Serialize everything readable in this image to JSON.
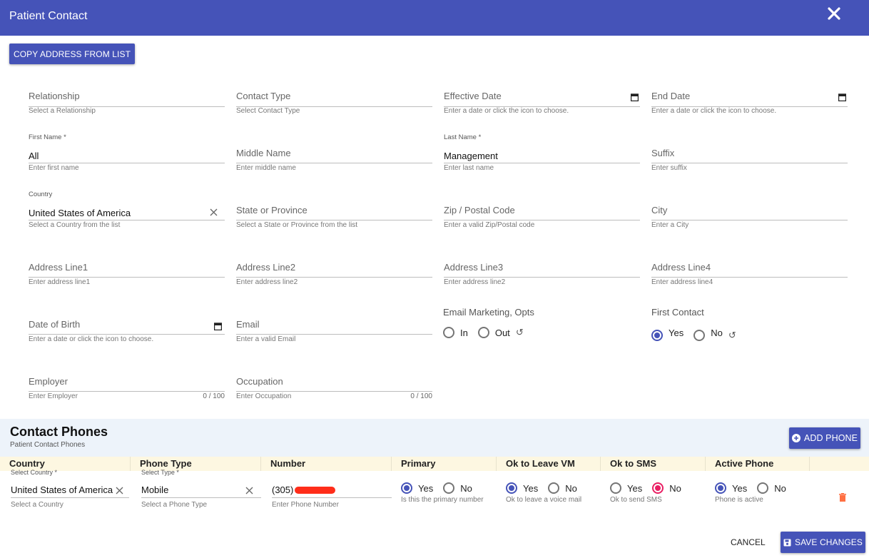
{
  "header": {
    "title": "Patient Contact"
  },
  "copy_button": "COPY ADDRESS FROM LIST",
  "form": {
    "relationship": {
      "label": "Relationship",
      "hint": "Select a Relationship"
    },
    "contact_type": {
      "label": "Contact Type",
      "hint": "Select Contact Type"
    },
    "effective_date": {
      "label": "Effective Date",
      "hint": "Enter a date or click the icon to choose."
    },
    "end_date": {
      "label": "End Date",
      "hint": "Enter a date or click the icon to choose."
    },
    "first_name": {
      "label": "First Name *",
      "value": "All",
      "hint": "Enter first name"
    },
    "middle_name": {
      "label": "Middle Name",
      "hint": "Enter middle name"
    },
    "last_name": {
      "label": "Last Name *",
      "value": "Management",
      "hint": "Enter last name"
    },
    "suffix": {
      "label": "Suffix",
      "hint": "Enter suffix"
    },
    "country": {
      "label": "Country",
      "value": "United States of America",
      "hint": "Select a Country from the list"
    },
    "state": {
      "label": "State or Province",
      "hint": "Select a State or Province from the list"
    },
    "zip": {
      "label": "Zip / Postal Code",
      "hint": "Enter a valid Zip/Postal code"
    },
    "city": {
      "label": "City",
      "hint": "Enter a City"
    },
    "address1": {
      "label": "Address Line1",
      "hint": "Enter address line1"
    },
    "address2": {
      "label": "Address Line2",
      "hint": "Enter address line2"
    },
    "address3": {
      "label": "Address Line3",
      "hint": "Enter address line2"
    },
    "address4": {
      "label": "Address Line4",
      "hint": "Enter address line4"
    },
    "dob": {
      "label": "Date of Birth",
      "hint": "Enter a date or click the icon to choose."
    },
    "email": {
      "label": "Email",
      "hint": "Enter a valid Email"
    },
    "email_marketing": {
      "label": "Email Marketing, Opts",
      "opt_in": "In",
      "opt_out": "Out"
    },
    "first_contact": {
      "label": "First Contact",
      "yes": "Yes",
      "no": "No",
      "selected": "Yes"
    },
    "employer": {
      "label": "Employer",
      "hint": "Enter Employer",
      "count": "0 / 100"
    },
    "occupation": {
      "label": "Occupation",
      "hint": "Enter Occupation",
      "count": "0 / 100"
    }
  },
  "phones": {
    "title": "Contact Phones",
    "subtitle": "Patient Contact Phones",
    "add_button": "ADD PHONE",
    "columns": [
      "Country",
      "Phone Type",
      "Number",
      "Primary",
      "Ok to Leave VM",
      "Ok to SMS",
      "Active Phone"
    ],
    "row": {
      "country_label": "Select Country *",
      "country_value": "United States of America",
      "country_hint": "Select a Country",
      "type_label": "Select Type *",
      "type_value": "Mobile",
      "type_hint": "Select a Phone Type",
      "number_prefix": "(305)",
      "number_hint": "Enter Phone Number",
      "yes": "Yes",
      "no": "No",
      "primary_hint": "Is this the primary number",
      "vm_hint": "Ok to leave a voice mail",
      "sms_hint": "Ok to send SMS",
      "active_hint": "Phone is active",
      "primary": "Yes",
      "vm": "Yes",
      "sms": "No",
      "active": "Yes"
    }
  },
  "footer": {
    "cancel": "CANCEL",
    "save": "SAVE CHANGES"
  },
  "colors": {
    "brand": "#4553b8",
    "accent": "#e91e63",
    "delete": "#ff7043",
    "redaction": "#ff2d1a"
  }
}
